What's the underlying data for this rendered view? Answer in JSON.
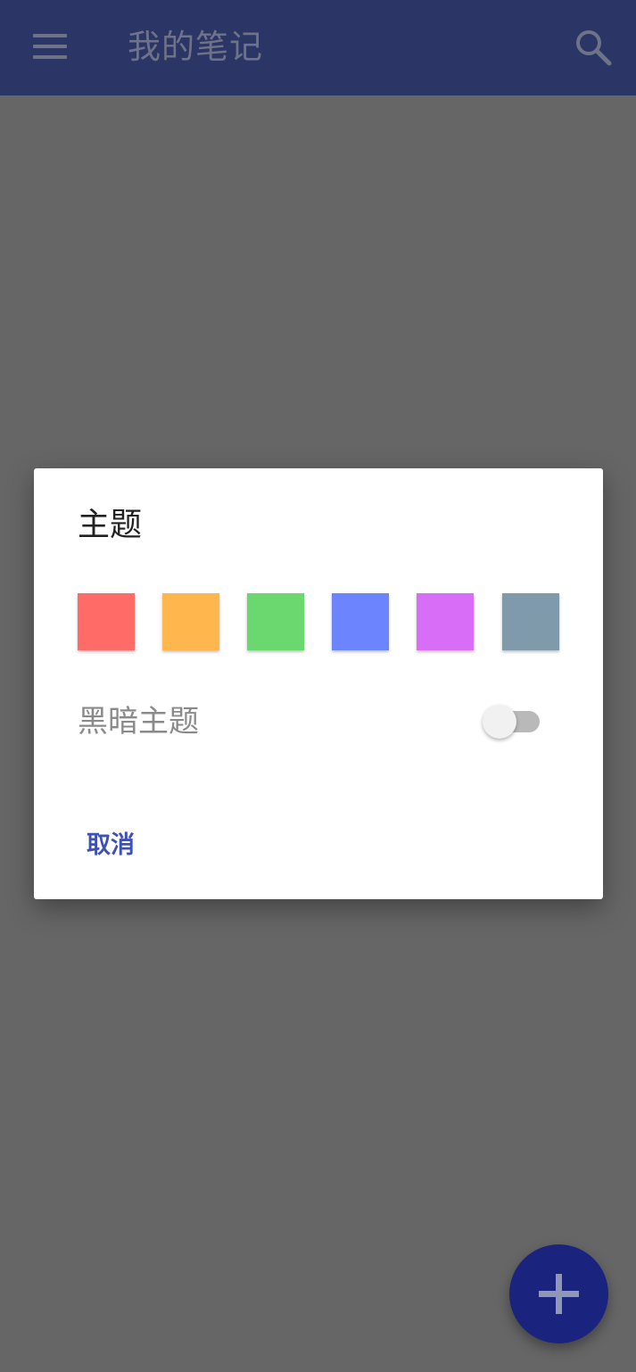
{
  "app_bar": {
    "title": "我的笔记",
    "menu_icon": "hamburger-menu-icon",
    "search_icon": "search-icon",
    "background_color": "#2b3566"
  },
  "dialog": {
    "title": "主题",
    "swatches": [
      {
        "color": "#ff6b66"
      },
      {
        "color": "#ffb74d"
      },
      {
        "color": "#6ad86f"
      },
      {
        "color": "#6d84ff"
      },
      {
        "color": "#d86df8"
      },
      {
        "color": "#7e9aab"
      }
    ],
    "dark_mode": {
      "label": "黑暗主题",
      "enabled": false
    },
    "cancel_label": "取消"
  },
  "fab": {
    "icon": "plus-icon",
    "color": "#1a237e"
  },
  "colors": {
    "scrim": "#666666",
    "accent_text": "#3f51b5"
  }
}
